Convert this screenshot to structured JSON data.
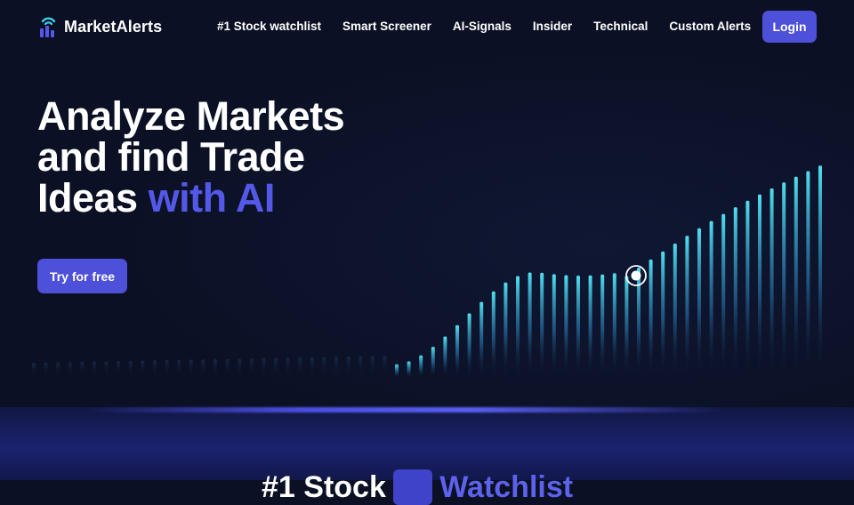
{
  "brand": {
    "name": "MarketAlerts",
    "logo_icon": "signal-chart-icon"
  },
  "nav": {
    "items": [
      {
        "label": "#1 Stock watchlist"
      },
      {
        "label": "Smart Screener"
      },
      {
        "label": "AI-Signals"
      },
      {
        "label": "Insider"
      },
      {
        "label": "Technical"
      },
      {
        "label": "Custom Alerts"
      }
    ],
    "login_label": "Login"
  },
  "hero": {
    "headline_line1": "Analyze Markets",
    "headline_line2": "and find Trade",
    "headline_line3_plain": "Ideas ",
    "headline_line3_accent": "with AI",
    "cta_label": "Try for free"
  },
  "section": {
    "heading_part1": "#1 Stock",
    "heading_part2": "...",
    "heading_part3": "Watchlist"
  },
  "colors": {
    "background": "#0b1024",
    "accent": "#4d50d9",
    "accent_text": "#5458e8",
    "bar_cyan": "#3fd0e8"
  }
}
